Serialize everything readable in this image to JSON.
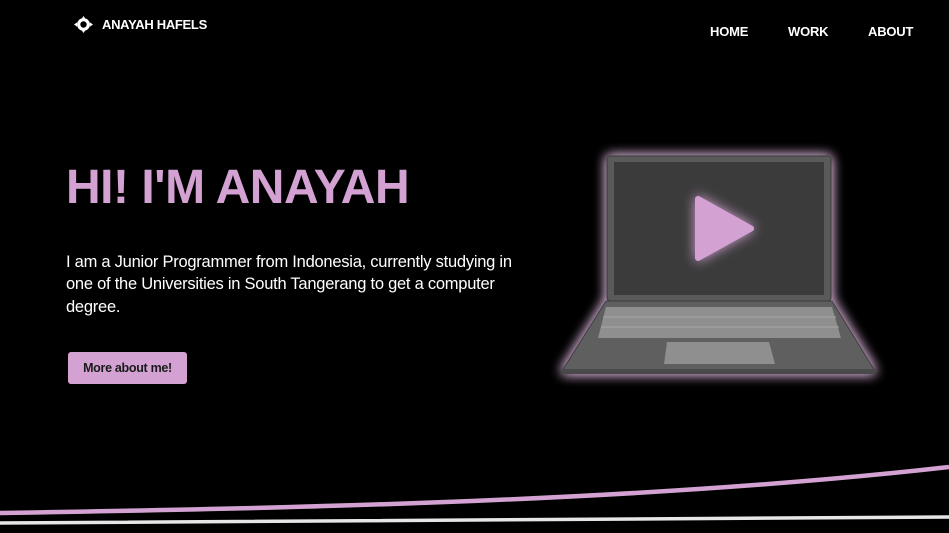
{
  "brand": {
    "name": "ANAYAH HAFELS",
    "icon": "eye-logo-icon"
  },
  "nav": [
    {
      "label": "HOME"
    },
    {
      "label": "WORK"
    },
    {
      "label": "ABOUT"
    }
  ],
  "hero": {
    "title": "HI! I'M ANAYAH",
    "description": "I am a Junior Programmer from Indonesia, currently studying in one of the Universities in South Tangerang to get a computer degree.",
    "cta_label": "More about me!"
  },
  "illustration": {
    "icon": "laptop-play-icon"
  },
  "colors": {
    "background": "#000000",
    "accent": "#d3a2d3",
    "text": "#ffffff",
    "laptop_body": "#5a5a5a",
    "laptop_screen": "#3b3b3b"
  }
}
